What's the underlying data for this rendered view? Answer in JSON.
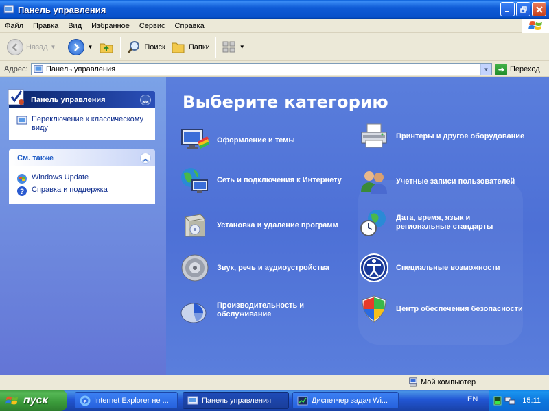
{
  "window": {
    "title": "Панель управления"
  },
  "menu": [
    "Файл",
    "Правка",
    "Вид",
    "Избранное",
    "Сервис",
    "Справка"
  ],
  "toolbar": {
    "back": "Назад",
    "search": "Поиск",
    "folders": "Папки"
  },
  "address": {
    "label": "Адрес:",
    "value": "Панель управления",
    "go": "Переход"
  },
  "left_panels": {
    "control_panel": {
      "title": "Панель управления",
      "items": [
        "Переключение к классическому виду"
      ]
    },
    "see_also": {
      "title": "См. также",
      "items": [
        "Windows Update",
        "Справка и поддержка"
      ]
    }
  },
  "main": {
    "heading": "Выберите категорию",
    "categories": [
      {
        "label": "Оформление и темы",
        "icon": "appearance-icon"
      },
      {
        "label": "Сеть и подключения к Интернету",
        "icon": "network-icon"
      },
      {
        "label": "Установка и удаление программ",
        "icon": "add-remove-programs-icon"
      },
      {
        "label": "Звук, речь и аудиоустройства",
        "icon": "speaker-icon"
      },
      {
        "label": "Производительность и обслуживание",
        "icon": "performance-icon"
      },
      {
        "label": "Принтеры и другое оборудование",
        "icon": "printer-icon"
      },
      {
        "label": "Учетные записи пользователей",
        "icon": "users-icon"
      },
      {
        "label": "Дата, время, язык и региональные стандарты",
        "icon": "date-time-icon"
      },
      {
        "label": "Специальные возможности",
        "icon": "accessibility-icon"
      },
      {
        "label": "Центр обеспечения безопасности",
        "icon": "security-shield-icon"
      }
    ]
  },
  "statusbar": {
    "location": "Мой компьютер"
  },
  "taskbar": {
    "start": "пуск",
    "tasks": [
      {
        "label": "Internet Explorer не ..."
      },
      {
        "label": "Панель управления"
      },
      {
        "label": "Диспетчер задач Wi..."
      }
    ],
    "language": "EN",
    "clock": "15:11"
  }
}
